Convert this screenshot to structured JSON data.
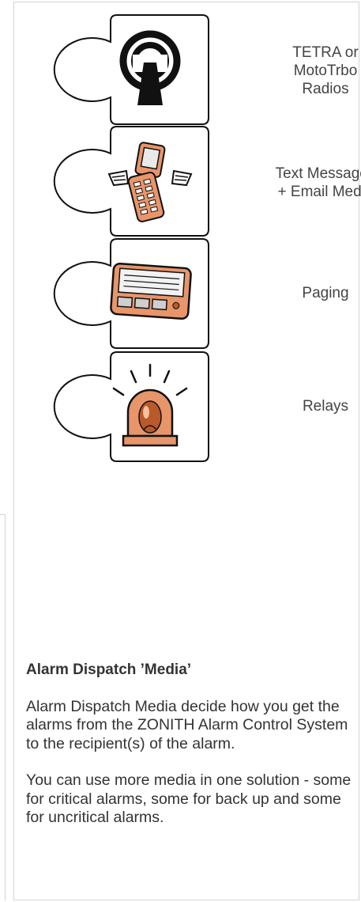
{
  "pieces": [
    {
      "icon": "radio-tower-icon",
      "label": "TETRA or\nMotoTrbo\nRadios"
    },
    {
      "icon": "winged-phone-icon",
      "label": "Text Messages\n+ Email Media"
    },
    {
      "icon": "pager-icon",
      "label": "Paging"
    },
    {
      "icon": "alarm-light-icon",
      "label": "Relays"
    }
  ],
  "section": {
    "heading": "Alarm Dispatch ’Media’",
    "paragraph_1": "Alarm Dispatch Media decide how you get the alarms from the ZONITH Alarm Control System to the recipient(s) of the alarm.",
    "paragraph_2": "You can use more media in one solution - some for critical alarms, some for back up and some for uncritical alarms."
  },
  "colors": {
    "accent": "#E8956A",
    "accent_dark": "#B85A2A",
    "outline": "#111111"
  }
}
